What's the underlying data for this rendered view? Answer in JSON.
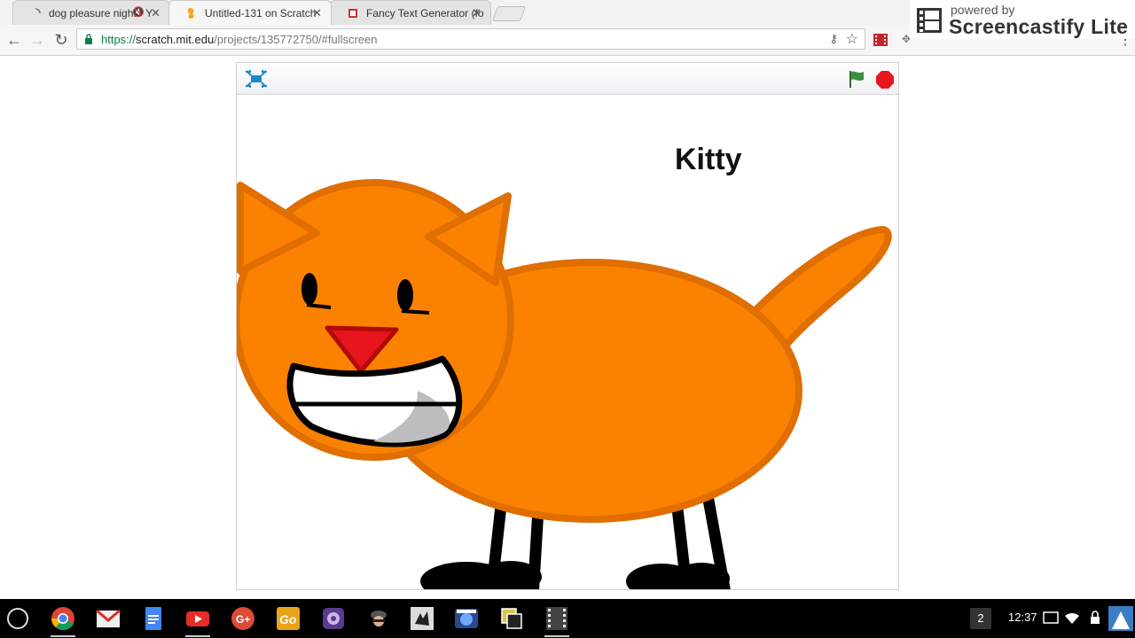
{
  "browser": {
    "tabs": [
      {
        "title": "dog pleasure night - Y",
        "audio": "🔇",
        "close": "✕"
      },
      {
        "title": "Untitled-131 on Scratch",
        "close": "✕"
      },
      {
        "title": "Fancy Text Generator (fo",
        "close": "✕"
      }
    ],
    "url": {
      "scheme": "https://",
      "host": "scratch.mit.edu",
      "path": "/projects/135772750/#fullscreen"
    },
    "nav": {
      "back": "←",
      "forward": "→",
      "reload": "↻"
    },
    "omnibox_icons": {
      "key": "⚷",
      "star": "☆"
    }
  },
  "screencastify": {
    "powered_by": "powered by",
    "brand": "Screencastify Lite"
  },
  "scratch": {
    "sprite_label": "Kitty",
    "colors": {
      "body": "#fb8200",
      "outline": "#e06e00",
      "nose": "#e8141e",
      "flag": "#3d8f3d",
      "stop": "#e8141e"
    }
  },
  "shelf": {
    "apps": [
      "chrome-icon",
      "gmail-icon",
      "docs-icon",
      "youtube-icon",
      "google-plus-icon",
      "go-app-icon",
      "camera-app-icon",
      "spy-app-icon",
      "paint-app-icon",
      "video-app-icon",
      "files-app-icon",
      "film-app-icon"
    ],
    "notification_count": "2",
    "time": "12:37"
  }
}
